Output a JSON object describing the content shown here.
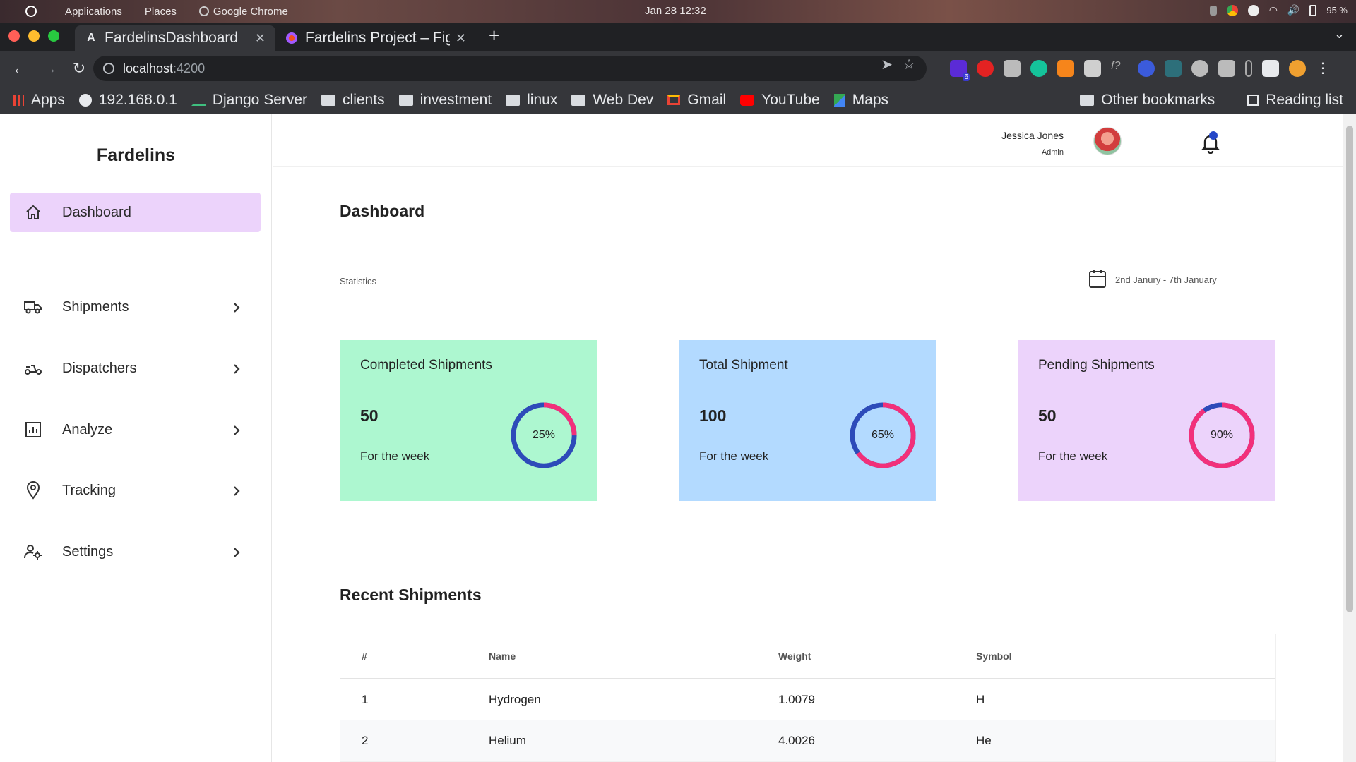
{
  "os": {
    "menu": [
      "Applications",
      "Places",
      "Google Chrome"
    ],
    "clock": "Jan 28  12:32",
    "battery": "95 %"
  },
  "browser": {
    "tabs": [
      {
        "title": "FardelinsDashboard",
        "favicon": "A"
      },
      {
        "title": "Fardelins Project – Figma",
        "favicon": "figma-icon"
      }
    ],
    "url_host": "localhost",
    "url_port": ":4200",
    "extension_badge": "6",
    "bookmarks": [
      "Apps",
      "192.168.0.1",
      "Django Server",
      "clients",
      "investment",
      "linux",
      "Web Dev",
      "Gmail",
      "YouTube",
      "Maps"
    ],
    "bookmarks_right": [
      "Other bookmarks",
      "Reading list"
    ]
  },
  "sidebar": {
    "brand": "Fardelins",
    "items": [
      {
        "label": "Dashboard",
        "icon": "home-icon",
        "active": true
      },
      {
        "label": "Shipments",
        "icon": "truck-icon"
      },
      {
        "label": "Dispatchers",
        "icon": "scooter-icon"
      },
      {
        "label": "Analyze",
        "icon": "chart-icon"
      },
      {
        "label": "Tracking",
        "icon": "location-pin-icon"
      },
      {
        "label": "Settings",
        "icon": "user-settings-icon"
      }
    ]
  },
  "header": {
    "user_name": "Jessica Jones",
    "user_role": "Admin"
  },
  "dashboard": {
    "title": "Dashboard",
    "stats_label": "Statistics",
    "date_range": "2nd Janury - 7th January",
    "cards": [
      {
        "title": "Completed Shipments",
        "value": "50",
        "sub": "For the week",
        "percent_label": "25%",
        "percent": 25,
        "bg": "#adf7d0"
      },
      {
        "title": "Total Shipment",
        "value": "100",
        "sub": "For the week",
        "percent_label": "65%",
        "percent": 65,
        "bg": "#b3daff"
      },
      {
        "title": "Pending Shipments",
        "value": "50",
        "sub": "For the week",
        "percent_label": "90%",
        "percent": 90,
        "bg": "#ecd3fb"
      }
    ],
    "ring_colors": {
      "filled": "#f2307a",
      "remaining": "#2d4bb9"
    },
    "recent_title": "Recent Shipments",
    "table": {
      "headers": [
        "#",
        "Name",
        "Weight",
        "Symbol"
      ],
      "rows": [
        [
          "1",
          "Hydrogen",
          "1.0079",
          "H"
        ],
        [
          "2",
          "Helium",
          "4.0026",
          "He"
        ]
      ]
    }
  }
}
